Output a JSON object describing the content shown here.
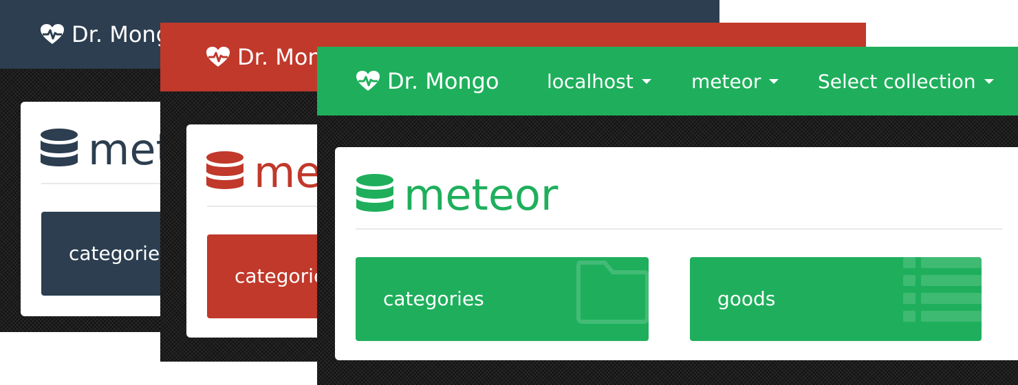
{
  "app": {
    "brand": "Dr. Mongo"
  },
  "themes": {
    "navy": {
      "accent": "#2c3e50"
    },
    "red": {
      "accent": "#c0392b"
    },
    "green": {
      "accent": "#1faf5c"
    }
  },
  "front": {
    "nav": {
      "server": "localhost",
      "database": "meteor",
      "collection": "Select collection"
    },
    "database_title": "meteor",
    "collections": [
      {
        "label": "categories",
        "icon": "folder-icon"
      },
      {
        "label": "goods",
        "icon": "list-icon"
      }
    ]
  }
}
